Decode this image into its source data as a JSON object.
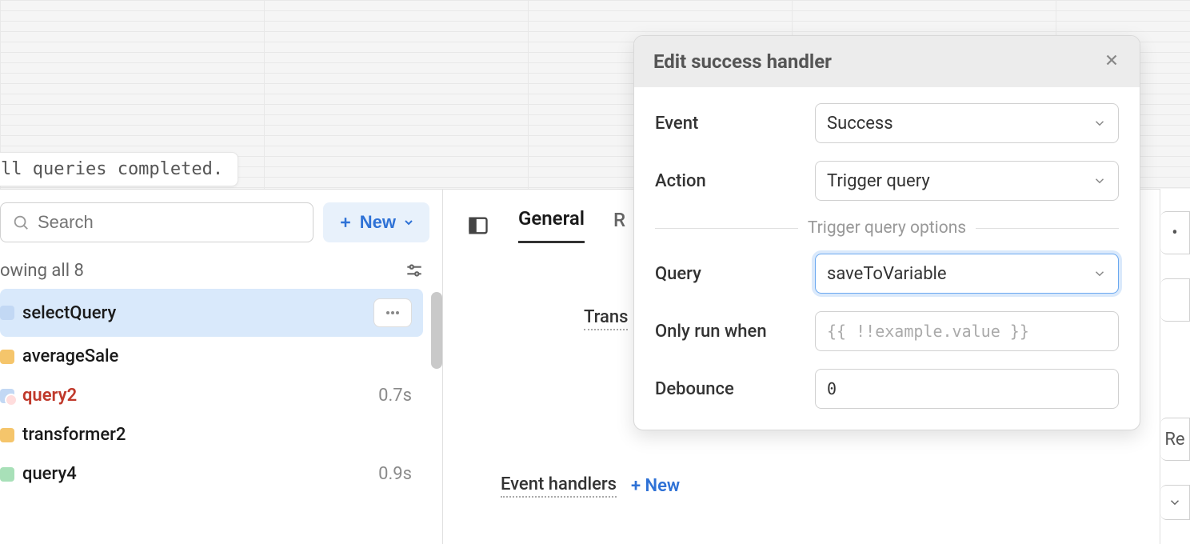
{
  "status": "ll queries completed.",
  "search": {
    "placeholder": "Search"
  },
  "new_button": {
    "label": "New"
  },
  "showing": "owing all 8",
  "queries": [
    {
      "name": "selectQuery",
      "time": "",
      "active": true,
      "color": "blue"
    },
    {
      "name": "averageSale",
      "time": "",
      "active": false,
      "color": "orange"
    },
    {
      "name": "query2",
      "time": "0.7s",
      "active": false,
      "color": "blue-err",
      "error": true
    },
    {
      "name": "transformer2",
      "time": "",
      "active": false,
      "color": "orange"
    },
    {
      "name": "query4",
      "time": "0.9s",
      "active": false,
      "color": "green"
    }
  ],
  "tabs": {
    "general": "General",
    "second": "R"
  },
  "transform_label": "Trans",
  "event_handlers": {
    "label": "Event handlers",
    "new": "+ New"
  },
  "popover": {
    "title": "Edit success handler",
    "fields": {
      "event": {
        "label": "Event",
        "value": "Success"
      },
      "action": {
        "label": "Action",
        "value": "Trigger query"
      },
      "options_divider": "Trigger query options",
      "query": {
        "label": "Query",
        "value": "saveToVariable"
      },
      "only_run": {
        "label": "Only run when",
        "placeholder": "{{ !!example.value }}"
      },
      "debounce": {
        "label": "Debounce",
        "value": "0"
      }
    }
  },
  "right": {
    "label": "Re"
  }
}
